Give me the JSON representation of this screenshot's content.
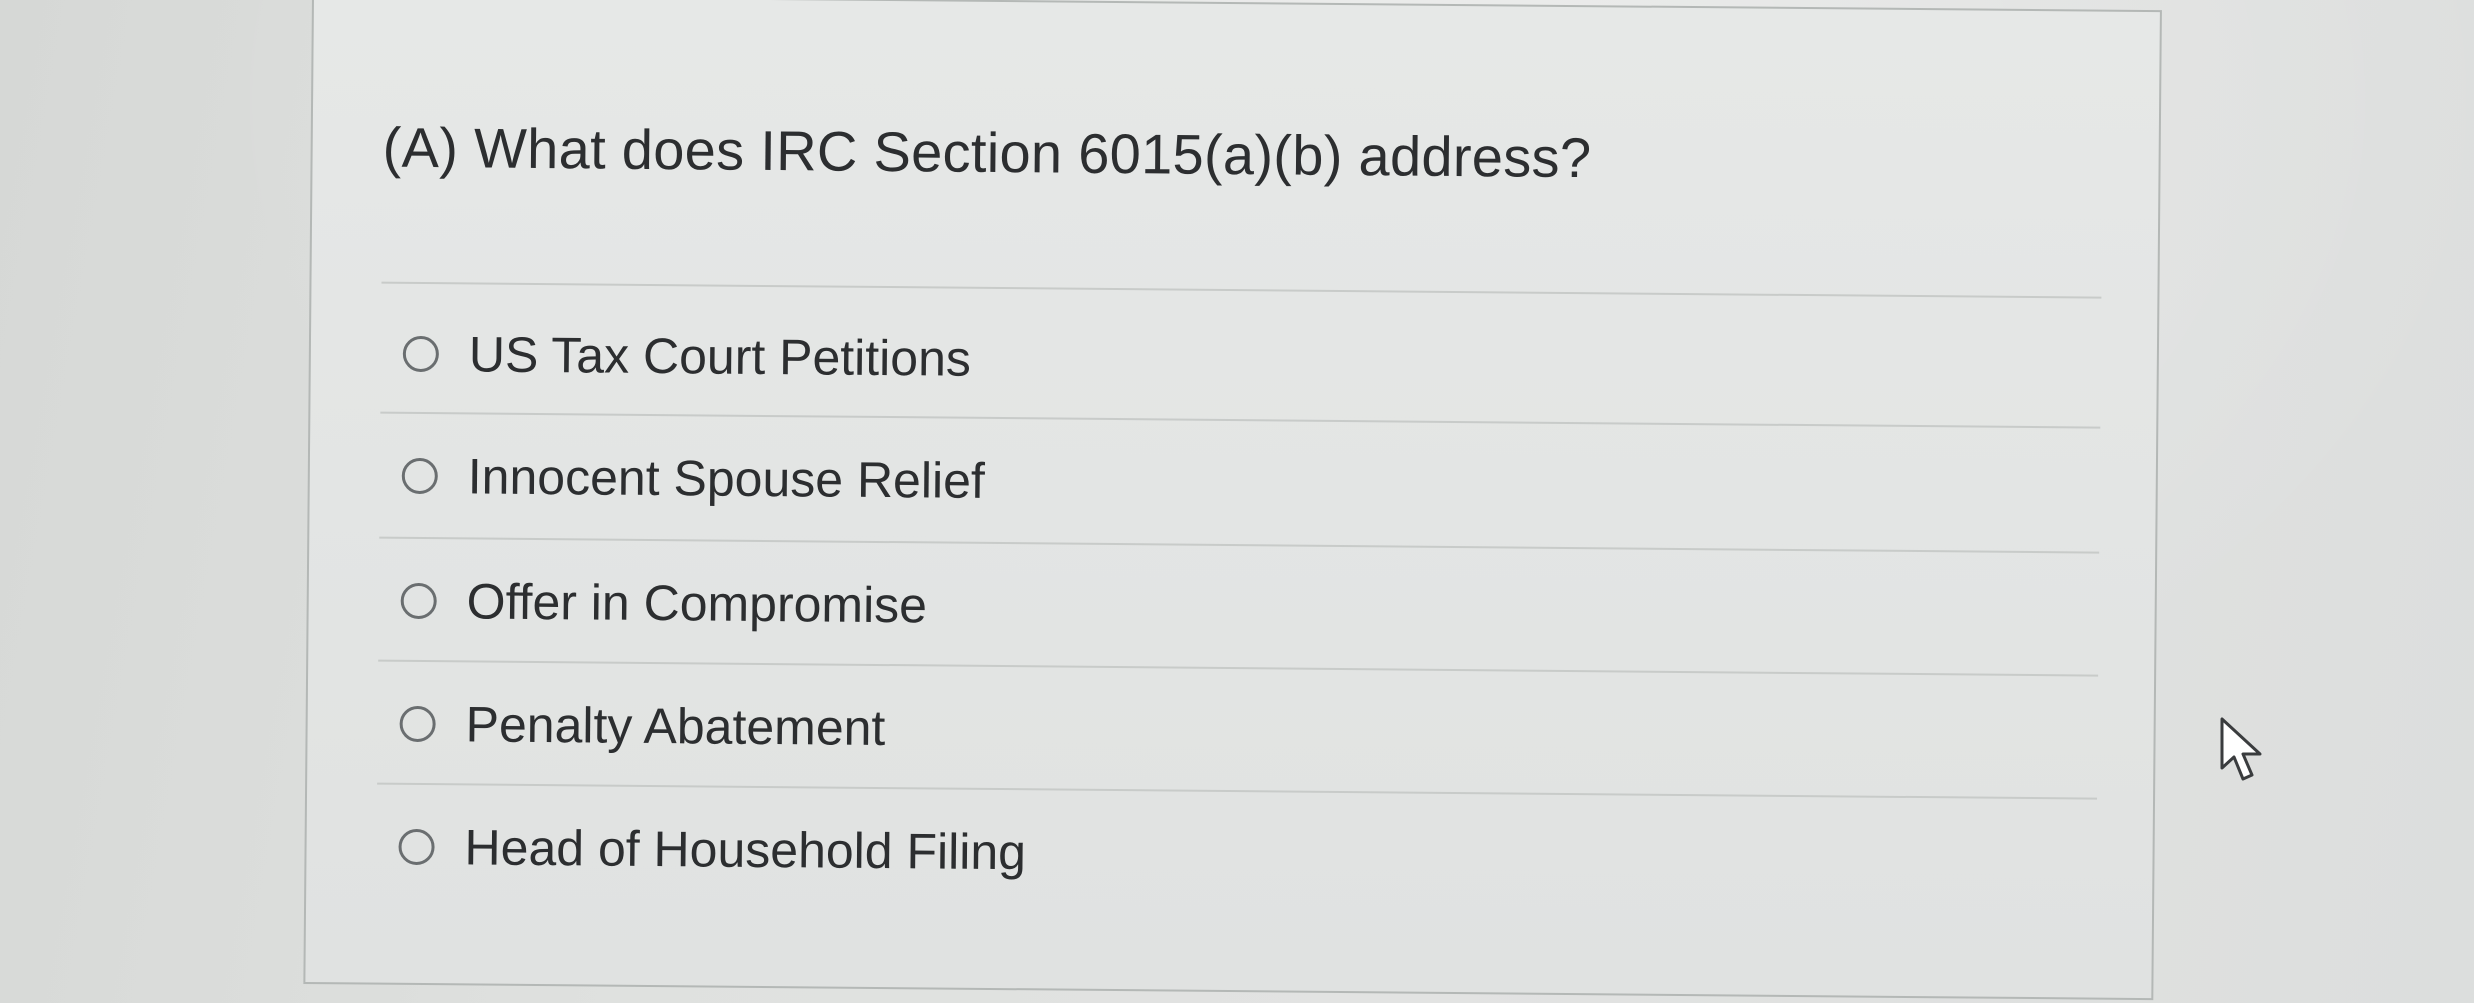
{
  "question": {
    "prompt": "(A) What does IRC Section 6015(a)(b) address?"
  },
  "choices": [
    {
      "label": "US Tax Court Petitions",
      "selected": false
    },
    {
      "label": "Innocent Spouse Relief",
      "selected": false
    },
    {
      "label": "Offer in Compromise",
      "selected": false
    },
    {
      "label": "Penalty Abatement",
      "selected": false
    },
    {
      "label": "Head of Household Filing",
      "selected": false
    }
  ],
  "icons": {
    "radio": "radio-unselected-icon",
    "cursor": "mouse-pointer-icon"
  },
  "colors": {
    "text": "#2c2e30",
    "radio_border": "#6a6e70",
    "divider": "#c8cbc9"
  }
}
